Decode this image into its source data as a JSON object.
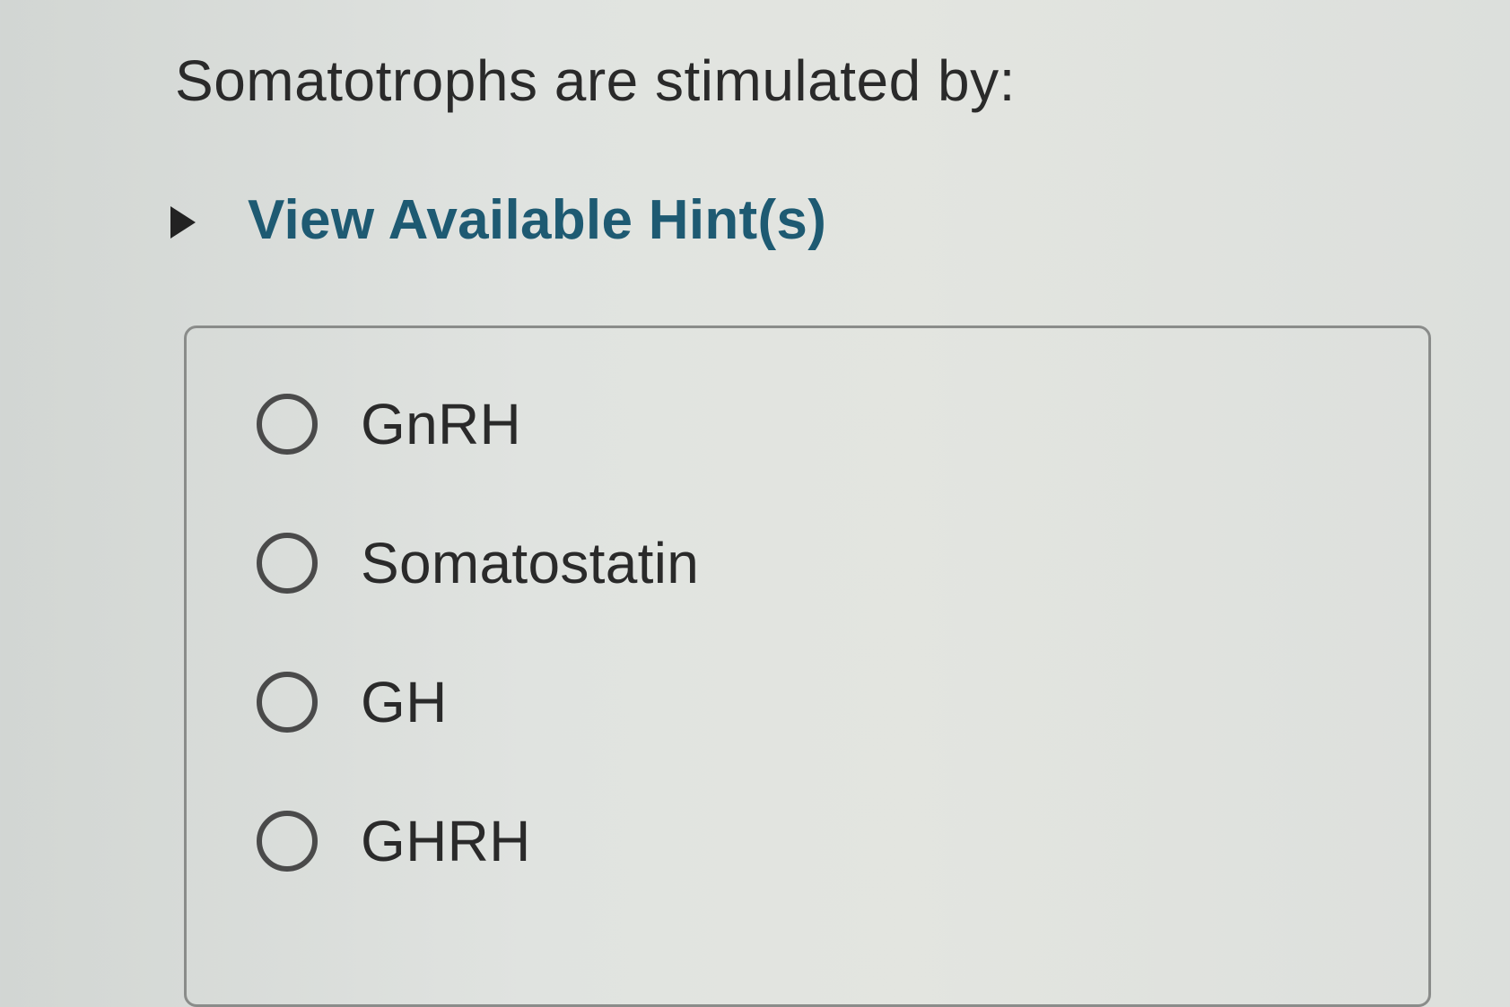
{
  "question": {
    "text": "Somatotrophs are stimulated by:"
  },
  "hint": {
    "label": "View Available Hint(s)",
    "icon": "caret-right-icon"
  },
  "options": [
    {
      "label": "GnRH",
      "selected": false
    },
    {
      "label": "Somatostatin",
      "selected": false
    },
    {
      "label": "GH",
      "selected": false
    },
    {
      "label": "GHRH",
      "selected": false
    }
  ],
  "colors": {
    "hint_link": "#1e5a72",
    "text": "#2a2a2a",
    "border": "#8a8c8a"
  }
}
